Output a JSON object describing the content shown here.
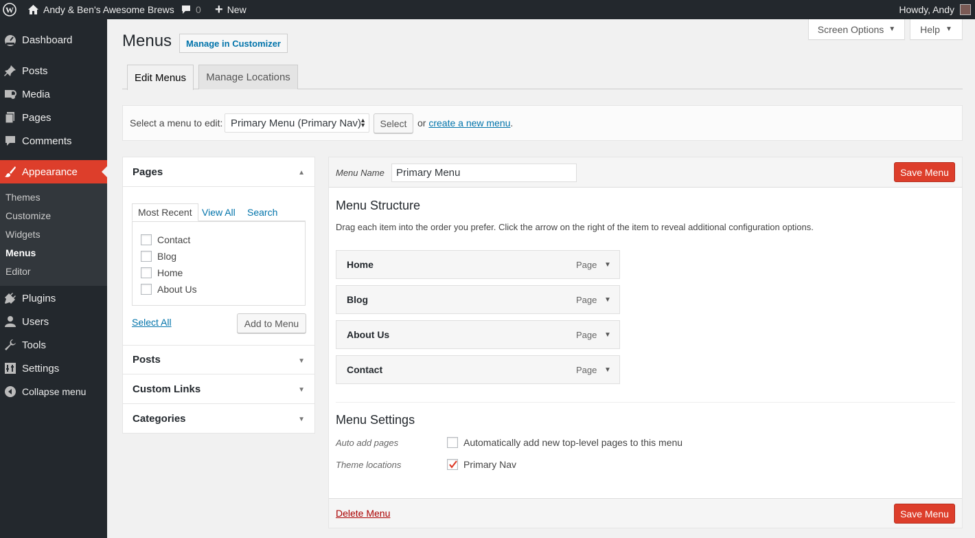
{
  "adminbar": {
    "site_name": "Andy & Ben's Awesome Brews",
    "comments_count": "0",
    "new_label": "New",
    "howdy": "Howdy, Andy"
  },
  "sidebar": {
    "items": [
      {
        "label": "Dashboard",
        "icon": "dashboard-icon"
      },
      {
        "label": "Posts",
        "icon": "pin-icon"
      },
      {
        "label": "Media",
        "icon": "media-icon"
      },
      {
        "label": "Pages",
        "icon": "pages-icon"
      },
      {
        "label": "Comments",
        "icon": "comment-icon"
      },
      {
        "label": "Appearance",
        "icon": "brush-icon"
      },
      {
        "label": "Plugins",
        "icon": "plug-icon"
      },
      {
        "label": "Users",
        "icon": "user-icon"
      },
      {
        "label": "Tools",
        "icon": "wrench-icon"
      },
      {
        "label": "Settings",
        "icon": "settings-icon"
      },
      {
        "label": "Collapse menu",
        "icon": "collapse-icon"
      }
    ],
    "submenu": [
      "Themes",
      "Customize",
      "Widgets",
      "Menus",
      "Editor"
    ]
  },
  "top_tabs": {
    "screen_options": "Screen Options",
    "help": "Help"
  },
  "page": {
    "title": "Menus",
    "manage_customizer": "Manage in Customizer",
    "tabs": [
      "Edit Menus",
      "Manage Locations"
    ]
  },
  "select_bar": {
    "label": "Select a menu to edit:",
    "selected": "Primary Menu (Primary Nav)",
    "button": "Select",
    "or": "or",
    "create_link": "create a new menu",
    "period": "."
  },
  "accordion": {
    "pages_title": "Pages",
    "inner_tabs": [
      "Most Recent",
      "View All",
      "Search"
    ],
    "pages": [
      "Contact",
      "Blog",
      "Home",
      "About Us"
    ],
    "select_all": "Select All",
    "add_to_menu": "Add to Menu",
    "sections": [
      "Posts",
      "Custom Links",
      "Categories"
    ]
  },
  "editor": {
    "menu_name_label": "Menu Name",
    "menu_name_value": "Primary Menu",
    "save": "Save Menu",
    "structure_title": "Menu Structure",
    "structure_desc": "Drag each item into the order you prefer. Click the arrow on the right of the item to reveal additional configuration options.",
    "items": [
      {
        "title": "Home",
        "type": "Page"
      },
      {
        "title": "Blog",
        "type": "Page"
      },
      {
        "title": "About Us",
        "type": "Page"
      },
      {
        "title": "Contact",
        "type": "Page"
      }
    ],
    "settings_title": "Menu Settings",
    "auto_add_label": "Auto add pages",
    "auto_add_option": "Automatically add new top-level pages to this menu",
    "locations_label": "Theme locations",
    "location_option": "Primary Nav",
    "delete": "Delete Menu"
  },
  "colors": {
    "accent": "#dd3e2b",
    "sidebar_bg": "#23282d",
    "link": "#0073aa"
  }
}
